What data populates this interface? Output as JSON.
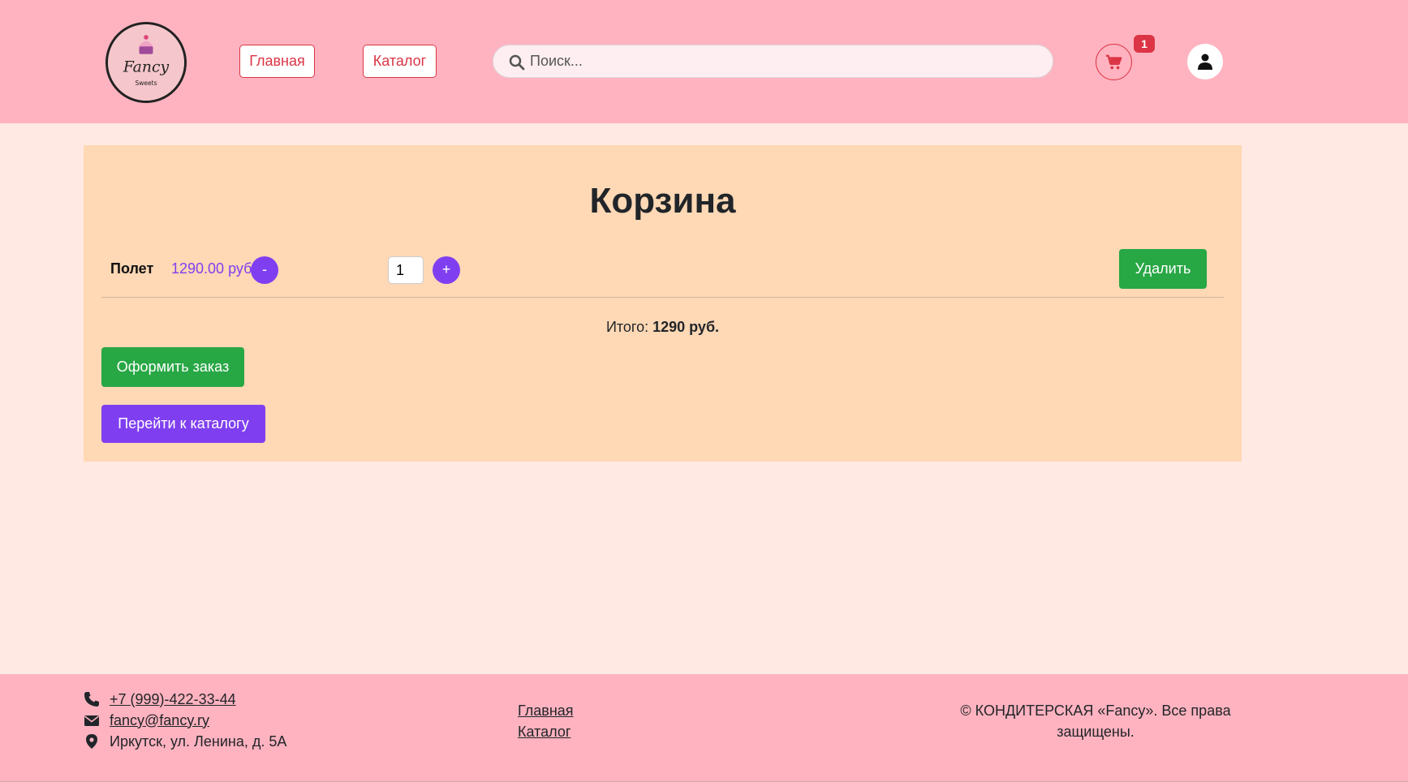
{
  "header": {
    "logo_text": "Fancy",
    "logo_subtext": "Sweets",
    "nav": [
      {
        "label": "Главная"
      },
      {
        "label": "Каталог"
      }
    ],
    "search": {
      "placeholder": "Поиск...",
      "value": ""
    },
    "cart_count": "1",
    "icons": {
      "search": "search-icon",
      "cart": "cart-icon",
      "user": "user-icon"
    }
  },
  "cart": {
    "title": "Корзина",
    "items": [
      {
        "name": "Полет",
        "price": "1290.00 руб.",
        "minus_label": "-",
        "plus_label": "+",
        "quantity": "1",
        "delete_label": "Удалить"
      }
    ],
    "total_label": "Итого:",
    "total_value": "1290 руб.",
    "checkout_label": "Оформить заказ",
    "to_catalog_label": "Перейти к каталогу"
  },
  "footer": {
    "phone": "+7 (999)-422-33-44",
    "email": "fancy@fancy.ry",
    "address": "Иркутск, ул. Ленина, д. 5А",
    "links": [
      {
        "label": "Главная"
      },
      {
        "label": "Каталог"
      }
    ],
    "copyright_line1": "© КОНДИТЕРСКАЯ «Fancy». Все права",
    "copyright_line2": "защищены."
  },
  "colors": {
    "header_bg": "#ffb3c0",
    "page_bg": "#ffe9e2",
    "panel_bg": "#ffd8b5",
    "accent_red": "#dc3545",
    "accent_purple": "#7f3ff0",
    "accent_green": "#28a745"
  }
}
